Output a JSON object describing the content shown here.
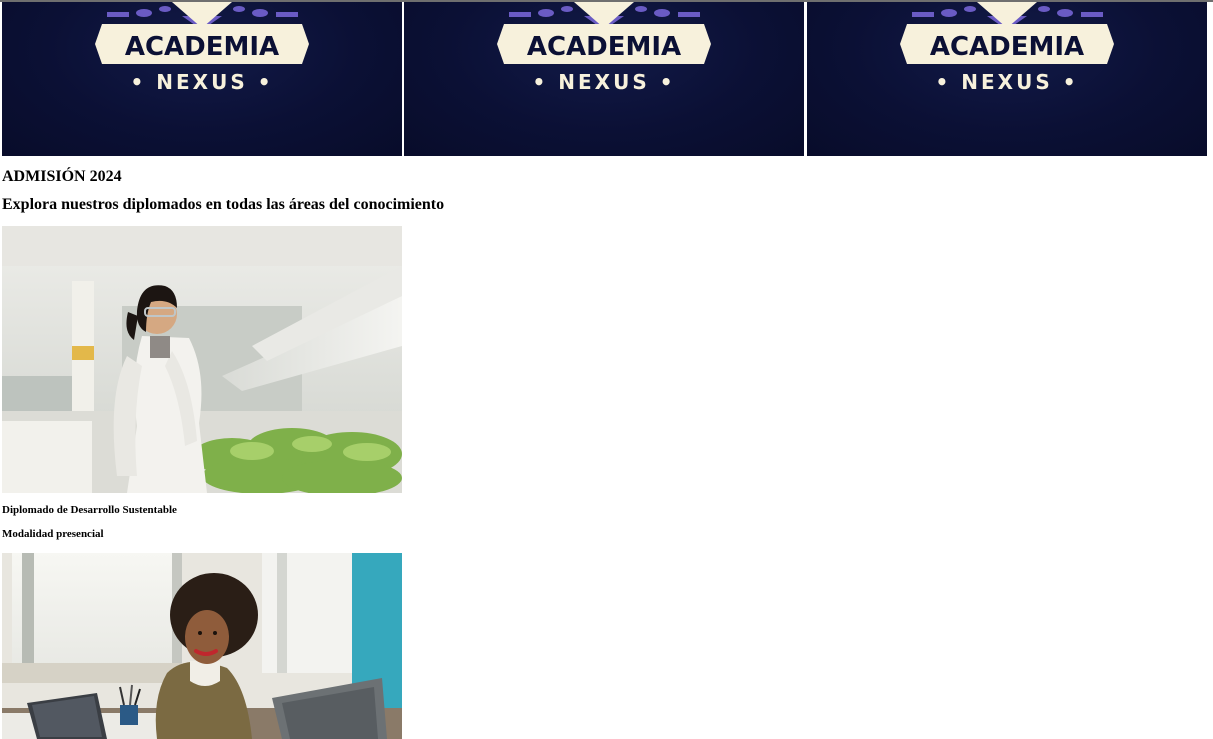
{
  "banner": {
    "logo_word": "ACADEMIA",
    "logo_subword": "• NEXUS •",
    "repeat_count": 3,
    "background_color": "#0b1035",
    "ribbon_color": "#f7f1dc",
    "accent_color": "#6a5bc4"
  },
  "header": {
    "admission": "ADMISIÓN 2024",
    "tagline": "Explora nuestros diplomados en todas las áreas del conocimiento"
  },
  "courses": [
    {
      "title": "Diplomado de Desarrollo Sustentable",
      "modality": "Modalidad presencial",
      "image": "scientist-greenhouse-photo"
    },
    {
      "image": "woman-office-laptop-photo"
    }
  ]
}
